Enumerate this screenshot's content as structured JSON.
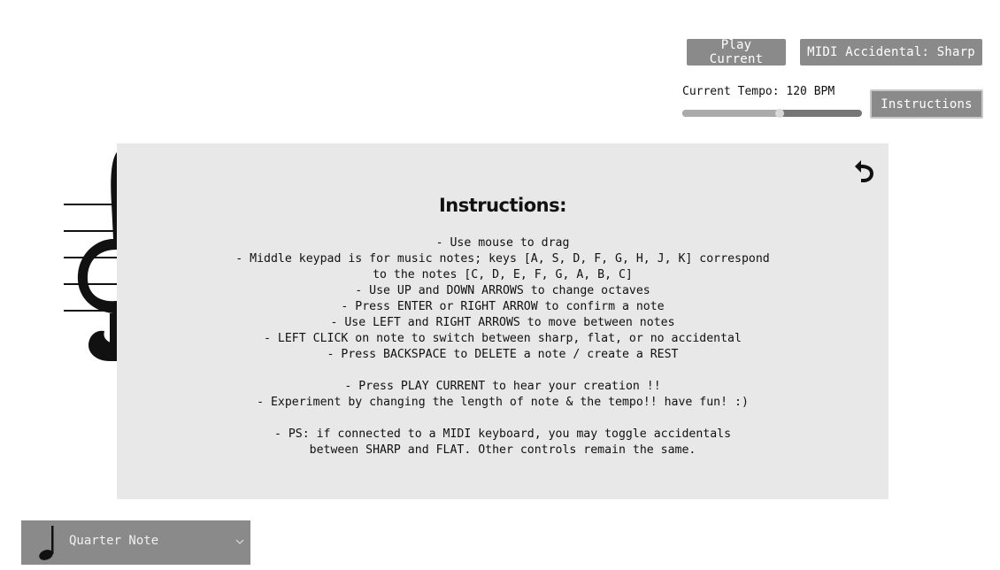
{
  "toolbar": {
    "play_label": "Play Current",
    "midi_label": "MIDI Accidental: Sharp",
    "instructions_label": "Instructions"
  },
  "tempo": {
    "label": "Current Tempo: 120 BPM",
    "value_fraction": 0.54
  },
  "modal": {
    "title": "Instructions:",
    "lines": [
      "- Use mouse to drag",
      "- Middle keypad is for music notes; keys [A, S, D, F, G, H, J, K] correspond",
      "to the notes [C, D, E, F, G, A, B, C]",
      "- Use UP and DOWN ARROWS to change octaves",
      "- Press ENTER or RIGHT ARROW to confirm a note",
      "- Use LEFT and RIGHT ARROWS to move between notes",
      "- LEFT CLICK on note to switch between sharp, flat, or no accidental",
      "- Press BACKSPACE to DELETE a note / create a REST",
      "",
      "- Press PLAY CURRENT to hear your creation !!",
      "- Experiment by changing the length of note & the tempo!! have fun! :)",
      "",
      "- PS: if connected to a MIDI keyboard, you may toggle accidentals",
      "between SHARP and FLAT. Other controls remain the same."
    ],
    "back_icon": "undo-arrow-icon"
  },
  "note_select": {
    "selected": "Quarter Note",
    "icon": "quarter-note-icon"
  },
  "colors": {
    "button_bg": "#8a8a8a",
    "modal_bg": "#e8e8e8"
  }
}
